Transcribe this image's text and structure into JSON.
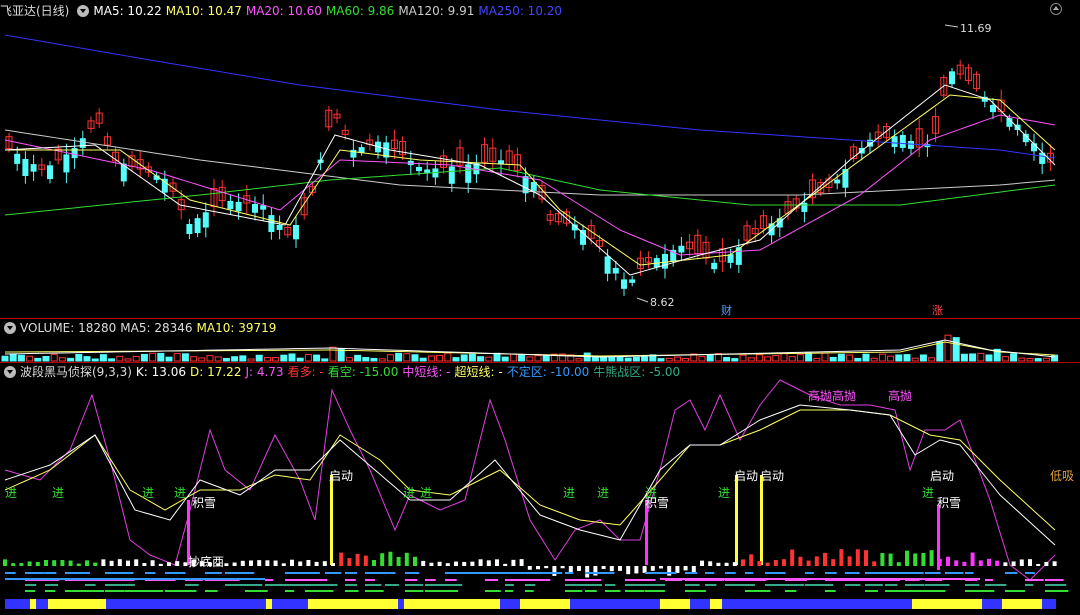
{
  "main_panel": {
    "title": "飞亚达(日线)",
    "ma5": "MA5: 10.22",
    "ma10": "MA10: 10.47",
    "ma20": "MA20: 10.60",
    "ma60": "MA60: 9.86",
    "ma120": "MA120: 9.91",
    "ma250": "MA250: 10.20",
    "high_label": "11.69",
    "low_label": "8.62",
    "marker_cai": "财",
    "marker_zhang": "涨"
  },
  "volume_panel": {
    "volume": "VOLUME: 18280",
    "ma5": "MA5: 28346",
    "ma10": "MA10: 39719"
  },
  "indicator_panel": {
    "name": "波段黑马侦探(9,3,3)",
    "k": "K: 13.06",
    "d": "D: 17.22",
    "j": "J: 4.73",
    "kanduo": "看多: -",
    "kankong": "看空: -15.00",
    "zhongduan": "中短线: -",
    "chaoduan": "超短线: -",
    "buding": "不定区: -10.00",
    "niuneng": "牛熊战区: -5.00",
    "signals": {
      "jin": "进",
      "jixue": "积雪",
      "chaodi": "抄底西",
      "qidong": "启动",
      "gaopao": "高抛",
      "dixi": "低吸"
    }
  },
  "colors": {
    "up": "#ff3333",
    "down": "#54fcfc",
    "ma5": "#ffffff",
    "ma10": "#ffff66",
    "ma20": "#ff55ff",
    "ma60": "#33dd33",
    "ma120": "#cccccc",
    "ma250": "#3333ff"
  }
}
